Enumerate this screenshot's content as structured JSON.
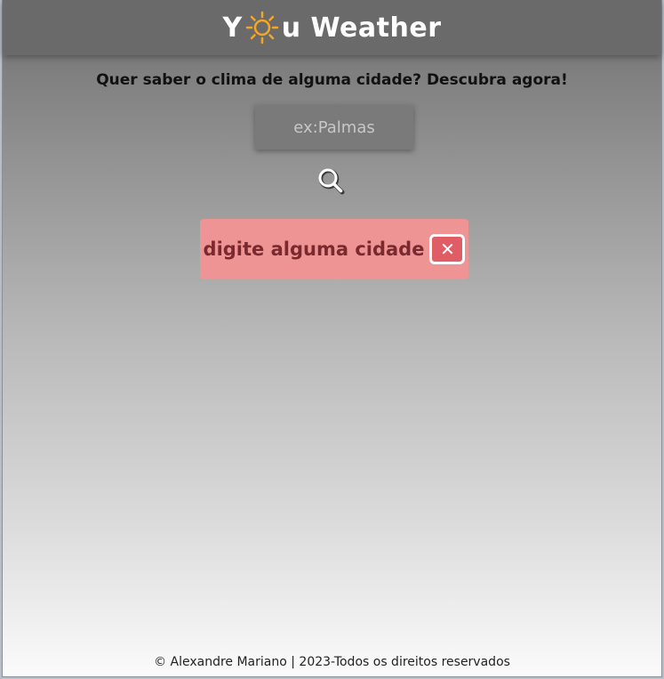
{
  "header": {
    "brand_prefix": "Y",
    "brand_suffix": "u Weather",
    "logo_icon": "sun-icon"
  },
  "main": {
    "tagline": "Quer saber o clima de alguma cidade? Descubra agora!",
    "search": {
      "placeholder": "ex:Palmas",
      "value": "",
      "button_icon": "search-icon"
    },
    "alert": {
      "message": "digite alguma cidade",
      "close_symbol": "✕",
      "close_icon": "close-icon"
    }
  },
  "footer": {
    "text": "© Alexandre Mariano | 2023-Todos os direitos reservados"
  },
  "colors": {
    "header_bg": "#6a6a6a",
    "sun": "#f5a623",
    "alert_bg": "#ef9494",
    "alert_text": "#7a2a2f",
    "close_bg": "#e05d66"
  }
}
